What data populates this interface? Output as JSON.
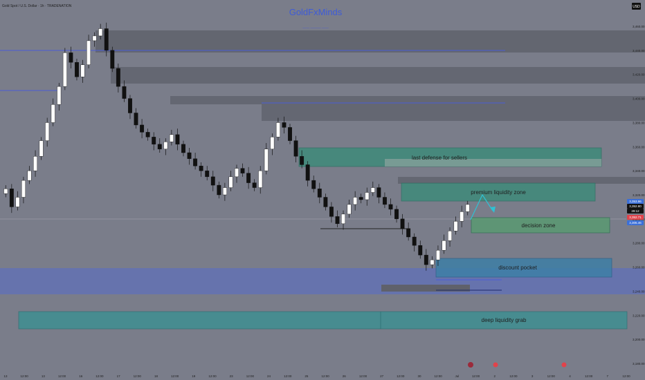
{
  "header": {
    "symbol_label": "Gold Spot / U.S. Dollar · 1h · TRADENATION",
    "brand": "GoldFxMinds",
    "brand_subtitle": "—— ——— ——",
    "currency_badge": "USD"
  },
  "colors": {
    "background": "#7a7d8a",
    "zone_dark": "#5f616b",
    "zone_green": "#3f8a7a",
    "zone_blue": "#3d7fa6",
    "zone_purple": "#6170b5",
    "zone_teal": "#3f8f92",
    "candle_up": "#ffffff",
    "candle_down": "#111111",
    "level_line": "#4a5cd6",
    "text": "#1e1e1e",
    "brand": "#3d5bd9"
  },
  "zones": [
    {
      "label": "last defense for sellers",
      "color": "green"
    },
    {
      "label": "premium liquidity zone",
      "color": "green"
    },
    {
      "label": "decision zone",
      "color": "green"
    },
    {
      "label": "discount pocket",
      "color": "blue"
    },
    {
      "label": "deep liquidity grab",
      "color": "teal"
    }
  ],
  "price_badges": [
    {
      "text": "3,353.96",
      "color": "#3b6fd8"
    },
    {
      "text": "3,352.80",
      "color": "#111111"
    },
    {
      "text": "29:12",
      "color": "#111111"
    },
    {
      "text": "3,352.71",
      "color": "#e0434b"
    },
    {
      "text": "3,305.46",
      "color": "#3b6fd8"
    }
  ],
  "chart_data": {
    "type": "candlestick",
    "instrument": "Gold Spot / U.S. Dollar",
    "timeframe": "1h",
    "y_ticks": [
      "3,460.00",
      "3,440.00",
      "3,420.00",
      "3,400.00",
      "3,380.00",
      "3,360.00",
      "3,340.00",
      "3,320.00",
      "3,300.00",
      "3,280.00",
      "3,260.00",
      "3,240.00",
      "3,220.00",
      "3,200.00",
      "3,180.00"
    ],
    "x_ticks": [
      "13",
      "12:00",
      "13",
      "12:00",
      "16",
      "12:00",
      "17",
      "12:00",
      "18",
      "12:00",
      "19",
      "12:00",
      "23",
      "12:00",
      "24",
      "12:00",
      "25",
      "12:00",
      "26",
      "12:00",
      "27",
      "12:00",
      "30",
      "12:00",
      "Jul",
      "12:00",
      "2",
      "12:00",
      "3",
      "12:00",
      "4",
      "12:00",
      "7",
      "12:00"
    ],
    "close_series": [
      3325,
      3310,
      3318,
      3332,
      3340,
      3352,
      3365,
      3380,
      3395,
      3410,
      3438,
      3430,
      3418,
      3428,
      3448,
      3452,
      3458,
      3440,
      3425,
      3410,
      3400,
      3388,
      3378,
      3372,
      3368,
      3362,
      3358,
      3364,
      3370,
      3362,
      3355,
      3350,
      3344,
      3340,
      3335,
      3328,
      3320,
      3326,
      3335,
      3342,
      3338,
      3330,
      3326,
      3340,
      3358,
      3368,
      3380,
      3376,
      3365,
      3352,
      3345,
      3332,
      3325,
      3318,
      3310,
      3302,
      3296,
      3304,
      3312,
      3318,
      3316,
      3322,
      3326,
      3318,
      3312,
      3308,
      3300,
      3292,
      3285,
      3278,
      3270,
      3262,
      3266,
      3274,
      3282,
      3290,
      3298,
      3306,
      3312
    ]
  }
}
